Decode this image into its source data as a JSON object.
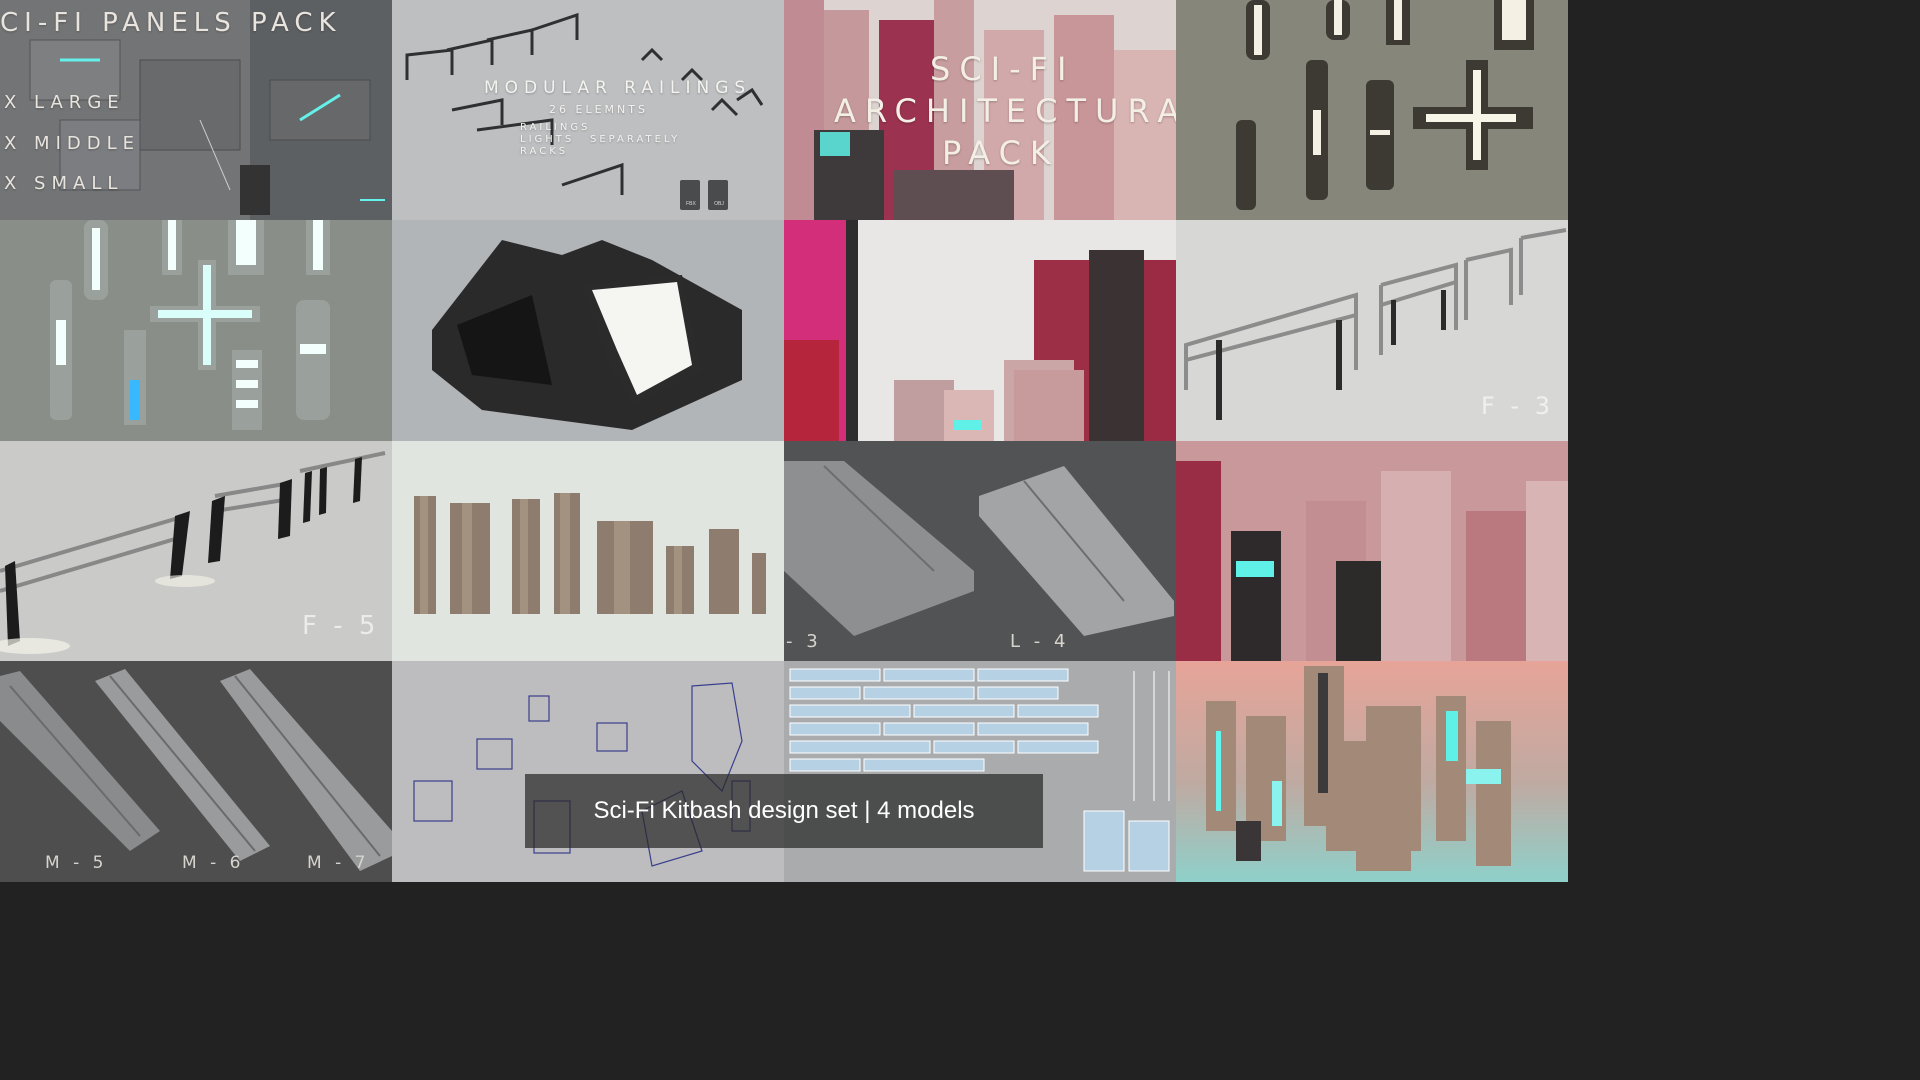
{
  "panels": {
    "title": "CI-FI PANELS PACK",
    "large": "X LARGE",
    "middle": "X MIDDLE",
    "small": "X SMALL"
  },
  "railings": {
    "title": "MODULAR RAILINGS",
    "count": "26 ELEMNTS",
    "list_1": "RAILINGS",
    "list_2": "LIGHTS",
    "list_3": "RACKS",
    "separately": "SEPARATELY",
    "file_fbx": "FBX",
    "file_obj": "OBJ"
  },
  "architectural": {
    "line1": "SCI-FI",
    "line2": "ARCHITECTURAL",
    "line3": "PACK"
  },
  "labels": {
    "f3": "F - 3",
    "f5": "F - 5",
    "l3": "- 3",
    "l4": "L - 4",
    "m5": "M - 5",
    "m6": "M - 6",
    "m7": "M - 7"
  },
  "overlay_text": "Sci-Fi Kitbash design set | 4 models",
  "colors": {
    "pink_city": "#c98f95",
    "neon_cyan": "#5ff1e8",
    "neutral_grey": "#8e8e8e"
  }
}
